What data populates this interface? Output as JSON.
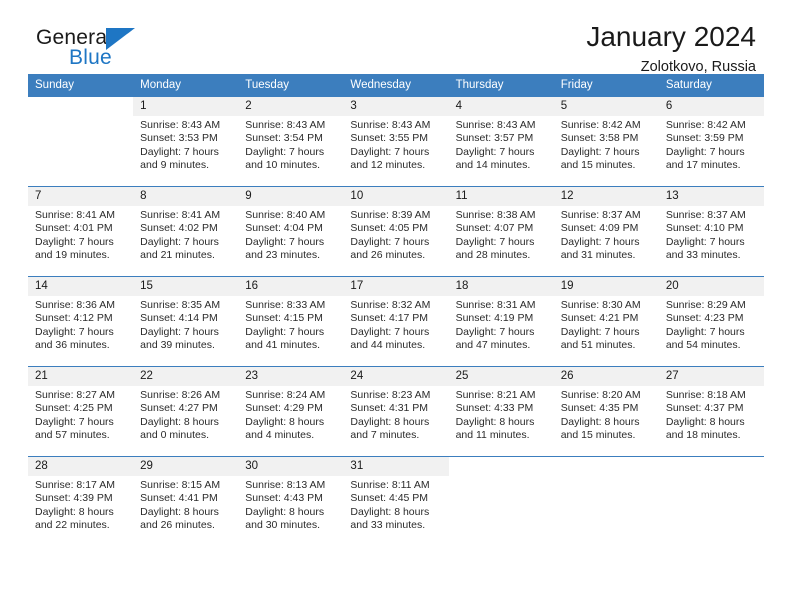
{
  "brand": {
    "name_top": "General",
    "name_bottom": "Blue",
    "accent_color": "#1e76c4"
  },
  "header": {
    "title": "January 2024",
    "subtitle": "Zolotkovo, Russia"
  },
  "theme": {
    "header_bg": "#3c7ebe",
    "daynum_bg": "#f1f1f1",
    "grid_line": "#3c7ebe"
  },
  "weekday_headers": [
    "Sunday",
    "Monday",
    "Tuesday",
    "Wednesday",
    "Thursday",
    "Friday",
    "Saturday"
  ],
  "weeks": [
    [
      {
        "day": "",
        "lines": []
      },
      {
        "day": "1",
        "lines": [
          "Sunrise: 8:43 AM",
          "Sunset: 3:53 PM",
          "Daylight: 7 hours",
          "and 9 minutes."
        ]
      },
      {
        "day": "2",
        "lines": [
          "Sunrise: 8:43 AM",
          "Sunset: 3:54 PM",
          "Daylight: 7 hours",
          "and 10 minutes."
        ]
      },
      {
        "day": "3",
        "lines": [
          "Sunrise: 8:43 AM",
          "Sunset: 3:55 PM",
          "Daylight: 7 hours",
          "and 12 minutes."
        ]
      },
      {
        "day": "4",
        "lines": [
          "Sunrise: 8:43 AM",
          "Sunset: 3:57 PM",
          "Daylight: 7 hours",
          "and 14 minutes."
        ]
      },
      {
        "day": "5",
        "lines": [
          "Sunrise: 8:42 AM",
          "Sunset: 3:58 PM",
          "Daylight: 7 hours",
          "and 15 minutes."
        ]
      },
      {
        "day": "6",
        "lines": [
          "Sunrise: 8:42 AM",
          "Sunset: 3:59 PM",
          "Daylight: 7 hours",
          "and 17 minutes."
        ]
      }
    ],
    [
      {
        "day": "7",
        "lines": [
          "Sunrise: 8:41 AM",
          "Sunset: 4:01 PM",
          "Daylight: 7 hours",
          "and 19 minutes."
        ]
      },
      {
        "day": "8",
        "lines": [
          "Sunrise: 8:41 AM",
          "Sunset: 4:02 PM",
          "Daylight: 7 hours",
          "and 21 minutes."
        ]
      },
      {
        "day": "9",
        "lines": [
          "Sunrise: 8:40 AM",
          "Sunset: 4:04 PM",
          "Daylight: 7 hours",
          "and 23 minutes."
        ]
      },
      {
        "day": "10",
        "lines": [
          "Sunrise: 8:39 AM",
          "Sunset: 4:05 PM",
          "Daylight: 7 hours",
          "and 26 minutes."
        ]
      },
      {
        "day": "11",
        "lines": [
          "Sunrise: 8:38 AM",
          "Sunset: 4:07 PM",
          "Daylight: 7 hours",
          "and 28 minutes."
        ]
      },
      {
        "day": "12",
        "lines": [
          "Sunrise: 8:37 AM",
          "Sunset: 4:09 PM",
          "Daylight: 7 hours",
          "and 31 minutes."
        ]
      },
      {
        "day": "13",
        "lines": [
          "Sunrise: 8:37 AM",
          "Sunset: 4:10 PM",
          "Daylight: 7 hours",
          "and 33 minutes."
        ]
      }
    ],
    [
      {
        "day": "14",
        "lines": [
          "Sunrise: 8:36 AM",
          "Sunset: 4:12 PM",
          "Daylight: 7 hours",
          "and 36 minutes."
        ]
      },
      {
        "day": "15",
        "lines": [
          "Sunrise: 8:35 AM",
          "Sunset: 4:14 PM",
          "Daylight: 7 hours",
          "and 39 minutes."
        ]
      },
      {
        "day": "16",
        "lines": [
          "Sunrise: 8:33 AM",
          "Sunset: 4:15 PM",
          "Daylight: 7 hours",
          "and 41 minutes."
        ]
      },
      {
        "day": "17",
        "lines": [
          "Sunrise: 8:32 AM",
          "Sunset: 4:17 PM",
          "Daylight: 7 hours",
          "and 44 minutes."
        ]
      },
      {
        "day": "18",
        "lines": [
          "Sunrise: 8:31 AM",
          "Sunset: 4:19 PM",
          "Daylight: 7 hours",
          "and 47 minutes."
        ]
      },
      {
        "day": "19",
        "lines": [
          "Sunrise: 8:30 AM",
          "Sunset: 4:21 PM",
          "Daylight: 7 hours",
          "and 51 minutes."
        ]
      },
      {
        "day": "20",
        "lines": [
          "Sunrise: 8:29 AM",
          "Sunset: 4:23 PM",
          "Daylight: 7 hours",
          "and 54 minutes."
        ]
      }
    ],
    [
      {
        "day": "21",
        "lines": [
          "Sunrise: 8:27 AM",
          "Sunset: 4:25 PM",
          "Daylight: 7 hours",
          "and 57 minutes."
        ]
      },
      {
        "day": "22",
        "lines": [
          "Sunrise: 8:26 AM",
          "Sunset: 4:27 PM",
          "Daylight: 8 hours",
          "and 0 minutes."
        ]
      },
      {
        "day": "23",
        "lines": [
          "Sunrise: 8:24 AM",
          "Sunset: 4:29 PM",
          "Daylight: 8 hours",
          "and 4 minutes."
        ]
      },
      {
        "day": "24",
        "lines": [
          "Sunrise: 8:23 AM",
          "Sunset: 4:31 PM",
          "Daylight: 8 hours",
          "and 7 minutes."
        ]
      },
      {
        "day": "25",
        "lines": [
          "Sunrise: 8:21 AM",
          "Sunset: 4:33 PM",
          "Daylight: 8 hours",
          "and 11 minutes."
        ]
      },
      {
        "day": "26",
        "lines": [
          "Sunrise: 8:20 AM",
          "Sunset: 4:35 PM",
          "Daylight: 8 hours",
          "and 15 minutes."
        ]
      },
      {
        "day": "27",
        "lines": [
          "Sunrise: 8:18 AM",
          "Sunset: 4:37 PM",
          "Daylight: 8 hours",
          "and 18 minutes."
        ]
      }
    ],
    [
      {
        "day": "28",
        "lines": [
          "Sunrise: 8:17 AM",
          "Sunset: 4:39 PM",
          "Daylight: 8 hours",
          "and 22 minutes."
        ]
      },
      {
        "day": "29",
        "lines": [
          "Sunrise: 8:15 AM",
          "Sunset: 4:41 PM",
          "Daylight: 8 hours",
          "and 26 minutes."
        ]
      },
      {
        "day": "30",
        "lines": [
          "Sunrise: 8:13 AM",
          "Sunset: 4:43 PM",
          "Daylight: 8 hours",
          "and 30 minutes."
        ]
      },
      {
        "day": "31",
        "lines": [
          "Sunrise: 8:11 AM",
          "Sunset: 4:45 PM",
          "Daylight: 8 hours",
          "and 33 minutes."
        ]
      },
      {
        "day": "",
        "lines": []
      },
      {
        "day": "",
        "lines": []
      },
      {
        "day": "",
        "lines": []
      }
    ]
  ]
}
